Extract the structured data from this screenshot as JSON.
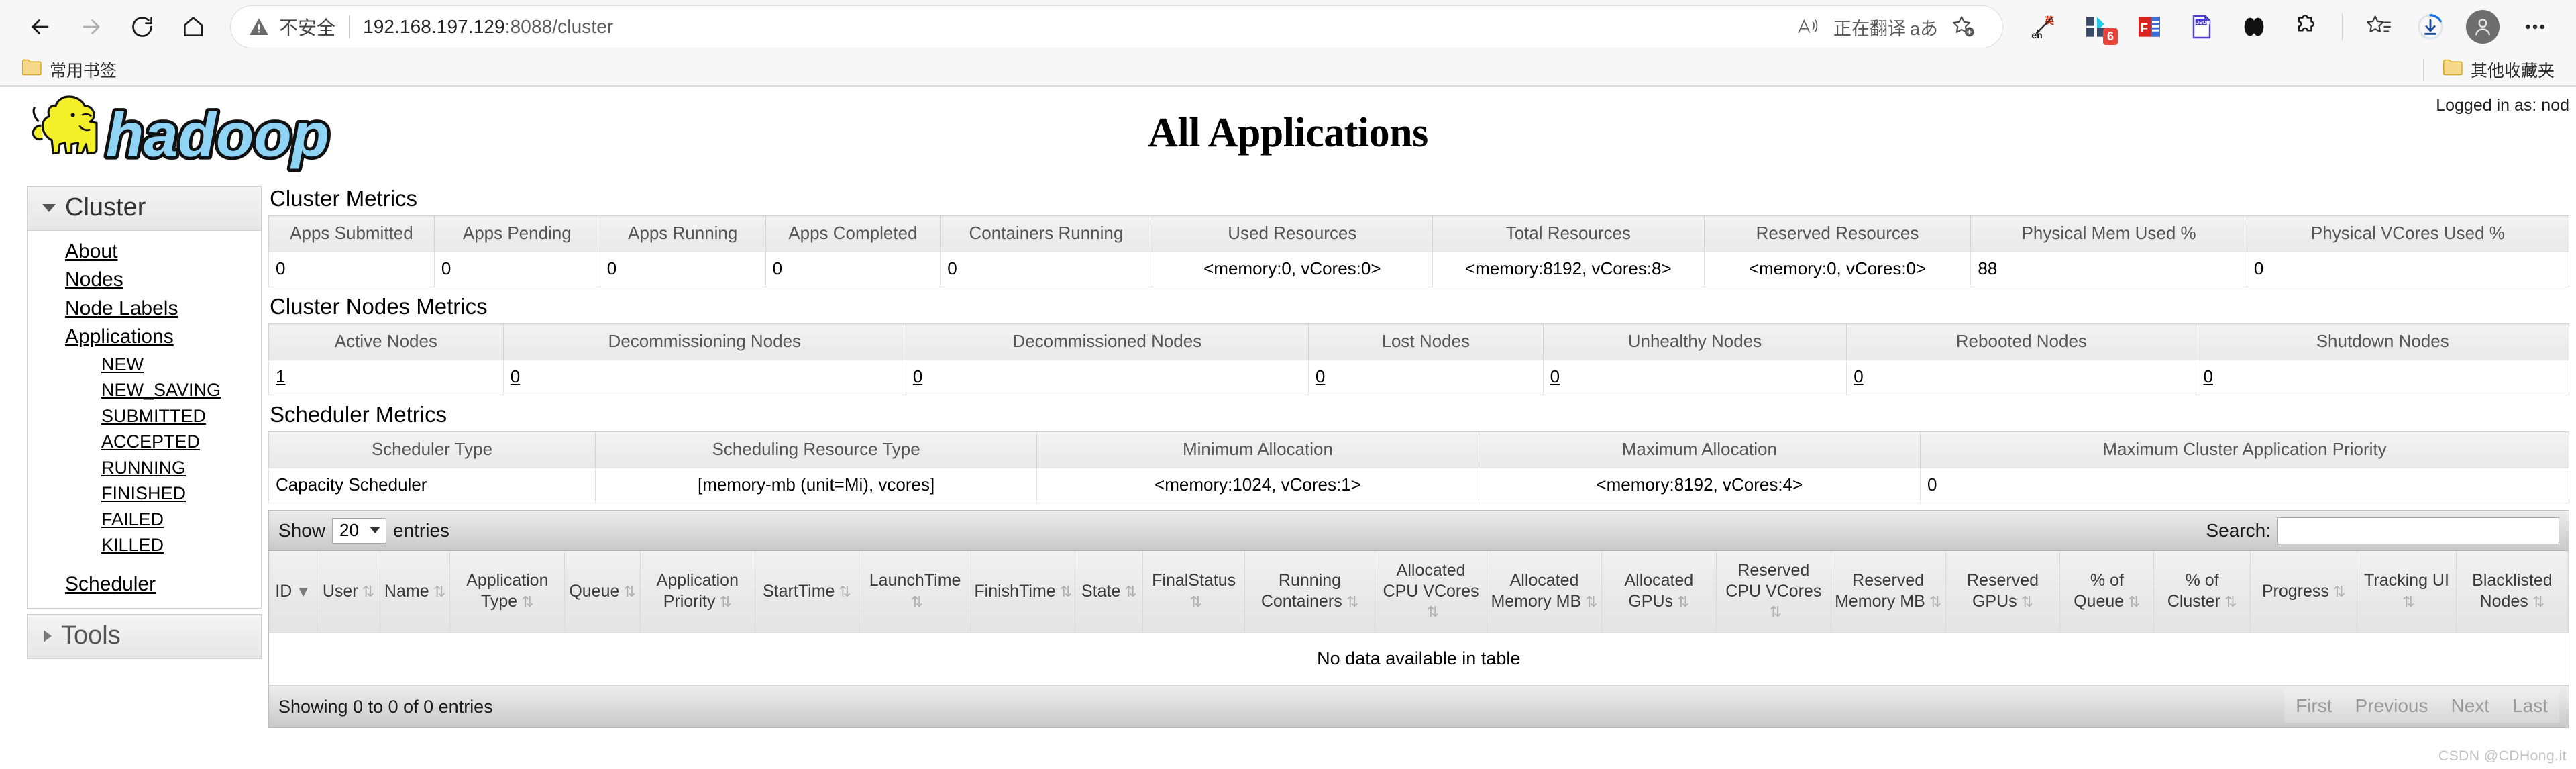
{
  "browser": {
    "back_icon": "arrow-left-icon",
    "forward_icon": "arrow-right-icon",
    "reload_icon": "reload-icon",
    "home_icon": "home-icon",
    "security_label": "不安全",
    "warning_icon": "warning-triangle-icon",
    "url_host": "192.168.197.129",
    "url_rest": ":8088/cluster",
    "read_aloud_icon": "read-aloud-icon",
    "translate_label": "正在翻译",
    "translate_aa": "aあ",
    "favorite_icon": "add-favorite-icon",
    "extensions": [
      {
        "name": "translate-extension-icon",
        "badge": ""
      },
      {
        "name": "pocket-extension-icon",
        "badge": "6"
      },
      {
        "name": "pdf-extension-icon",
        "badge": ""
      },
      {
        "name": "json-viewer-extension-icon",
        "badge": ""
      },
      {
        "name": "dark-reader-extension-icon",
        "badge": ""
      },
      {
        "name": "puzzle-extension-icon",
        "badge": ""
      }
    ],
    "collections_icon": "collections-icon",
    "downloads_icon": "downloads-icon",
    "profile_icon": "profile-avatar-icon",
    "settings_icon": "more-options-icon",
    "bookmarks": {
      "folder_icon": "folder-icon",
      "left_label": "常用书签",
      "right_label": "其他收藏夹"
    }
  },
  "page": {
    "logo_alt": "hadoop-logo",
    "title": "All Applications",
    "logged_in_as": "Logged in as: nod"
  },
  "sidebar": {
    "cluster": {
      "header": "Cluster",
      "links": [
        "About",
        "Nodes",
        "Node Labels",
        "Applications"
      ],
      "app_states": [
        "NEW",
        "NEW_SAVING",
        "SUBMITTED",
        "ACCEPTED",
        "RUNNING",
        "FINISHED",
        "FAILED",
        "KILLED"
      ],
      "scheduler": "Scheduler"
    },
    "tools": {
      "header": "Tools"
    }
  },
  "cluster_metrics": {
    "title": "Cluster Metrics",
    "headers": [
      "Apps Submitted",
      "Apps Pending",
      "Apps Running",
      "Apps Completed",
      "Containers Running",
      "Used Resources",
      "Total Resources",
      "Reserved Resources",
      "Physical Mem Used %",
      "Physical VCores Used %"
    ],
    "values": [
      "0",
      "0",
      "0",
      "0",
      "0",
      "<memory:0, vCores:0>",
      "<memory:8192, vCores:8>",
      "<memory:0, vCores:0>",
      "88",
      "0"
    ]
  },
  "cluster_nodes_metrics": {
    "title": "Cluster Nodes Metrics",
    "headers": [
      "Active Nodes",
      "Decommissioning Nodes",
      "Decommissioned Nodes",
      "Lost Nodes",
      "Unhealthy Nodes",
      "Rebooted Nodes",
      "Shutdown Nodes"
    ],
    "values": [
      "1",
      "0",
      "0",
      "0",
      "0",
      "0",
      "0"
    ]
  },
  "scheduler_metrics": {
    "title": "Scheduler Metrics",
    "headers": [
      "Scheduler Type",
      "Scheduling Resource Type",
      "Minimum Allocation",
      "Maximum Allocation",
      "Maximum Cluster Application Priority"
    ],
    "values": [
      "Capacity Scheduler",
      "[memory-mb (unit=Mi), vcores]",
      "<memory:1024, vCores:1>",
      "<memory:8192, vCores:4>",
      "0"
    ]
  },
  "apps_table": {
    "show_label": "Show",
    "entries_label": "entries",
    "page_size": "20",
    "search_label": "Search:",
    "search_value": "",
    "search_placeholder": "",
    "columns": [
      "ID",
      "User",
      "Name",
      "Application Type",
      "Queue",
      "Application Priority",
      "StartTime",
      "LaunchTime",
      "FinishTime",
      "State",
      "FinalStatus",
      "Running Containers",
      "Allocated CPU VCores",
      "Allocated Memory MB",
      "Allocated GPUs",
      "Reserved CPU VCores",
      "Reserved Memory MB",
      "Reserved GPUs",
      "% of Queue",
      "% of Cluster",
      "Progress",
      "Tracking UI",
      "Blacklisted Nodes"
    ],
    "empty_message": "No data available in table",
    "showing_text": "Showing 0 to 0 of 0 entries",
    "pagination": [
      "First",
      "Previous",
      "Next",
      "Last"
    ]
  },
  "watermark": "CSDN @CDHong.it"
}
